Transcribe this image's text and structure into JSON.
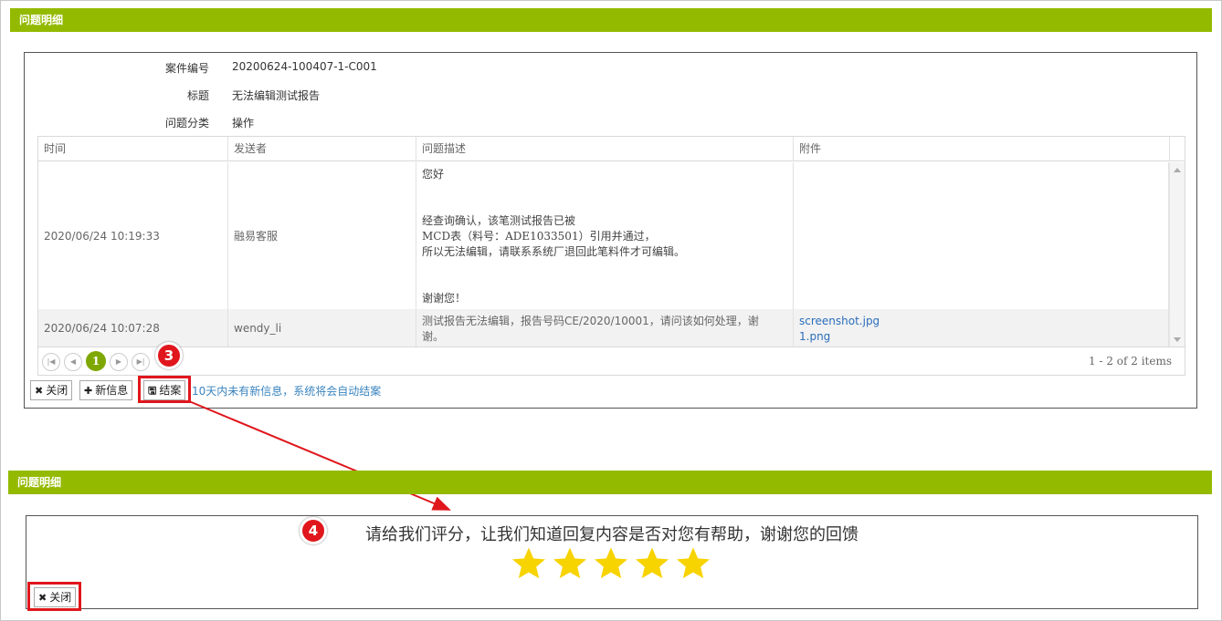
{
  "section1": {
    "title": "问题明细"
  },
  "section2": {
    "title": "问题明细"
  },
  "case": {
    "case_no_label": "案件编号",
    "case_no": "20200624-100407-1-C001",
    "title_label": "标题",
    "title": "无法编辑测试报告",
    "category_label": "问题分类",
    "category": "操作"
  },
  "grid": {
    "columns": [
      "时间",
      "发送者",
      "问题描述",
      "附件"
    ],
    "rows": [
      {
        "time": "2020/06/24 10:19:33",
        "sender": "融易客服",
        "description": "您好\n\n\n经查询确认，该笔测试报告已被\nMCD表（料号：ADE1033501）引用并通过，\n所以无法编辑，请联系系统厂退回此笔料件才可编辑。\n\n\n谢谢您！",
        "attachments": []
      },
      {
        "time": "2020/06/24 10:07:28",
        "sender": "wendy_li",
        "description": "测试报告无法编辑，报告号码CE/2020/10001，请问该如何处理，谢\n谢。",
        "attachments": [
          "screenshot.jpg",
          "1.png"
        ]
      }
    ],
    "pager": {
      "current_page": "1",
      "info": "1 - 2 of 2 items"
    }
  },
  "actions": {
    "close_label": "关闭",
    "new_label": "新信息",
    "close_case_label": "结案",
    "auto_close_note": "10天内未有新信息，系统将会自动结案"
  },
  "rating": {
    "prompt": "请给我们评分，让我们知道回复内容是否对您有帮助，谢谢您的回馈",
    "stars": 5,
    "star_color": "#f7d300",
    "close_label": "关闭"
  },
  "annotations": {
    "step3": "3",
    "step4": "4",
    "color": "#e0161c"
  }
}
